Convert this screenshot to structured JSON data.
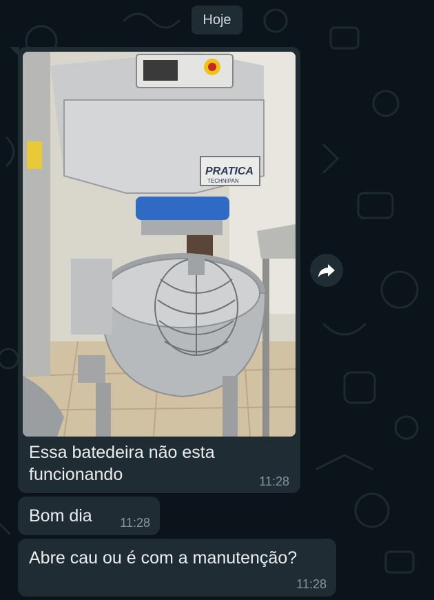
{
  "chat": {
    "date_label": "Hoje",
    "messages": [
      {
        "type": "image",
        "image_icon": "mixer-photo",
        "caption": "Essa batedeira não esta funcionando",
        "time": "11:28"
      },
      {
        "type": "text",
        "text": "Bom dia",
        "time": "11:28"
      },
      {
        "type": "text",
        "text": "Abre cau ou é com a manutenção?",
        "time": "11:28"
      }
    ],
    "forward_icon": "forward-arrow-icon",
    "photo_brand_text_1": "PRATICA",
    "photo_brand_text_2": "TECHNIPAN"
  },
  "colors": {
    "background": "#0b141a",
    "bubble": "#1f2c34",
    "text": "#e9edef",
    "meta": "#8696a0"
  }
}
